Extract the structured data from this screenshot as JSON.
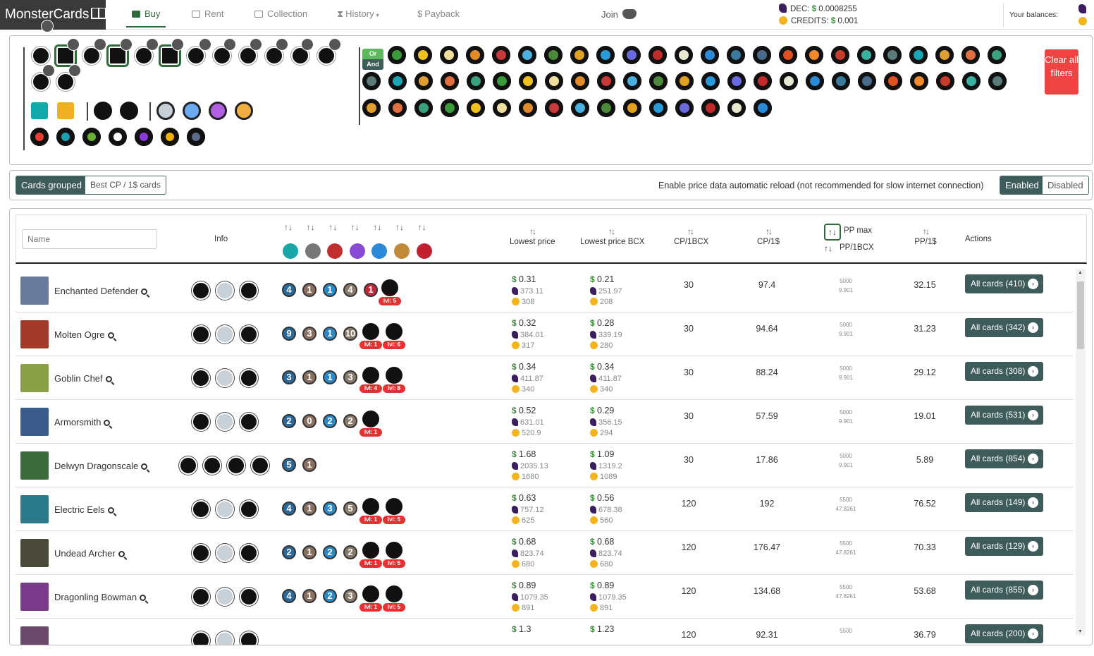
{
  "nav": {
    "brand": "MonsterCards",
    "tabs": [
      {
        "label": "Buy",
        "active": true
      },
      {
        "label": "Rent"
      },
      {
        "label": "Collection"
      },
      {
        "label": "History"
      },
      {
        "label": "Payback"
      }
    ],
    "join_label": "Join",
    "dec_label": "DEC:",
    "dec_price": "0.0008255",
    "credits_label": "CREDITS:",
    "credits_price": "0.001",
    "currency_symbol": "$",
    "balances_label": "Your balances:"
  },
  "filters": {
    "or_label": "Or",
    "and_label": "And",
    "clear_label": "Clear all filters"
  },
  "toggles": {
    "grouped_label": "Cards grouped",
    "best_label": "Best CP / 1$ cards",
    "reload_text": "Enable price data automatic reload (not recommended for slow internet connection)",
    "enabled_label": "Enabled",
    "disabled_label": "Disabled"
  },
  "table": {
    "name_placeholder": "Name",
    "headers": {
      "info": "Info",
      "lowest_price": "Lowest price",
      "lowest_price_bcx": "Lowest price BCX",
      "cp_bcx": "CP/1BCX",
      "cp_usd": "CP/1$",
      "pp_max": "PP max",
      "pp_bcx": "PP/1BCX",
      "pp_usd": "PP/1$",
      "actions": "Actions"
    },
    "rows": [
      {
        "name": "Enchanted Defender",
        "stats": [
          "4",
          "1",
          "1",
          "4",
          "1"
        ],
        "levels": [
          "lvl: 5"
        ],
        "price_usd": "0.31",
        "price_dec": "373.11",
        "price_cr": "308",
        "bcx_usd": "0.21",
        "bcx_dec": "251.97",
        "bcx_cr": "208",
        "cp_bcx": "30",
        "cp_usd": "97.4",
        "pp_max": "5000",
        "pp_bcx": "9.901",
        "pp_usd": "32.15",
        "action": "All cards (410)"
      },
      {
        "name": "Molten Ogre",
        "stats": [
          "9",
          "3",
          "1",
          "10"
        ],
        "levels": [
          "lvl: 1",
          "lvl: 6"
        ],
        "price_usd": "0.32",
        "price_dec": "384.01",
        "price_cr": "317",
        "bcx_usd": "0.28",
        "bcx_dec": "339.19",
        "bcx_cr": "280",
        "cp_bcx": "30",
        "cp_usd": "94.64",
        "pp_max": "5000",
        "pp_bcx": "9.901",
        "pp_usd": "31.23",
        "action": "All cards (342)"
      },
      {
        "name": "Goblin Chef",
        "stats": [
          "3",
          "1",
          "1",
          "3"
        ],
        "levels": [
          "lvl: 4",
          "lvl: 8"
        ],
        "price_usd": "0.34",
        "price_dec": "411.87",
        "price_cr": "340",
        "bcx_usd": "0.34",
        "bcx_dec": "411.87",
        "bcx_cr": "340",
        "cp_bcx": "30",
        "cp_usd": "88.24",
        "pp_max": "5000",
        "pp_bcx": "9.901",
        "pp_usd": "29.12",
        "action": "All cards (308)"
      },
      {
        "name": "Armorsmith",
        "stats": [
          "2",
          "0",
          "2",
          "2"
        ],
        "levels": [
          "lvl: 1"
        ],
        "price_usd": "0.52",
        "price_dec": "631.01",
        "price_cr": "520.9",
        "bcx_usd": "0.29",
        "bcx_dec": "356.15",
        "bcx_cr": "294",
        "cp_bcx": "30",
        "cp_usd": "57.59",
        "pp_max": "5000",
        "pp_bcx": "9.901",
        "pp_usd": "19.01",
        "action": "All cards (531)"
      },
      {
        "name": "Delwyn Dragonscale",
        "stats": [
          "5",
          "1"
        ],
        "levels": [],
        "price_usd": "1.68",
        "price_dec": "2035.13",
        "price_cr": "1680",
        "bcx_usd": "1.09",
        "bcx_dec": "1319.2",
        "bcx_cr": "1089",
        "cp_bcx": "30",
        "cp_usd": "17.86",
        "pp_max": "5000",
        "pp_bcx": "9.901",
        "pp_usd": "5.89",
        "action": "All cards (854)"
      },
      {
        "name": "Electric Eels",
        "stats": [
          "4",
          "1",
          "3",
          "5"
        ],
        "levels": [
          "lvl: 1",
          "lvl: 5"
        ],
        "price_usd": "0.63",
        "price_dec": "757.12",
        "price_cr": "625",
        "bcx_usd": "0.56",
        "bcx_dec": "678.38",
        "bcx_cr": "560",
        "cp_bcx": "120",
        "cp_usd": "192",
        "pp_max": "5500",
        "pp_bcx": "47.8261",
        "pp_usd": "76.52",
        "action": "All cards (149)"
      },
      {
        "name": "Undead Archer",
        "stats": [
          "2",
          "1",
          "2",
          "2"
        ],
        "levels": [
          "lvl: 1",
          "lvl: 5"
        ],
        "price_usd": "0.68",
        "price_dec": "823.74",
        "price_cr": "680",
        "bcx_usd": "0.68",
        "bcx_dec": "823.74",
        "bcx_cr": "680",
        "cp_bcx": "120",
        "cp_usd": "176.47",
        "pp_max": "5500",
        "pp_bcx": "47.8261",
        "pp_usd": "70.33",
        "action": "All cards (129)"
      },
      {
        "name": "Dragonling Bowman",
        "stats": [
          "4",
          "1",
          "2",
          "3"
        ],
        "levels": [
          "lvl: 1",
          "lvl: 5"
        ],
        "price_usd": "0.89",
        "price_dec": "1079.35",
        "price_cr": "891",
        "bcx_usd": "0.89",
        "bcx_dec": "1079.35",
        "bcx_cr": "891",
        "cp_bcx": "120",
        "cp_usd": "134.68",
        "pp_max": "5500",
        "pp_bcx": "47.8261",
        "pp_usd": "53.68",
        "action": "All cards (855)"
      },
      {
        "name": "",
        "stats": [],
        "levels": [],
        "price_usd": "1.3",
        "price_dec": "",
        "price_cr": "",
        "bcx_usd": "1.23",
        "bcx_dec": "",
        "bcx_cr": "",
        "cp_bcx": "120",
        "cp_usd": "92.31",
        "pp_max": "5500",
        "pp_bcx": "",
        "pp_usd": "36.79",
        "action": "All cards (200)"
      }
    ]
  },
  "colors": {
    "accent": "#2e6b3b",
    "button": "#3d5c5a",
    "clear": "#ee4444",
    "price_green": "#3a8a3a",
    "level_badge": "#e23232"
  }
}
